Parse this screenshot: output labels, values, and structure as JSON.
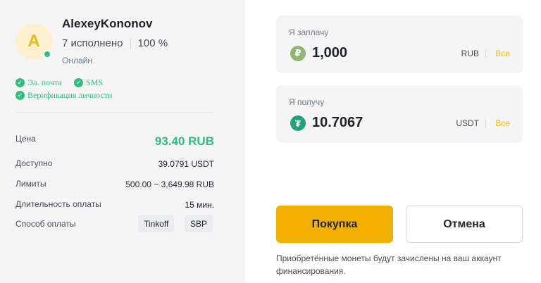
{
  "trader": {
    "avatar_letter": "A",
    "username": "AlexeyKononov",
    "orders_completed": "7 исполнено",
    "completion_rate": "100 %",
    "status": "Онлайн",
    "verifications": {
      "email": "Эл. почта",
      "sms": "SMS",
      "identity": "Верификация личности"
    }
  },
  "details": {
    "price_label": "Цена",
    "price_value": "93.40 RUB",
    "available_label": "Доступно",
    "available_value": "39.0791 USDT",
    "limits_label": "Лимиты",
    "limits_value": "500.00 ~ 3,649.98 RUB",
    "duration_label": "Длительность оплаты",
    "duration_value": "15 мин.",
    "payment_label": "Способ оплаты",
    "payment_methods": [
      "Tinkoff",
      "SBP"
    ]
  },
  "pay": {
    "label": "Я заплачу",
    "amount": "1,000",
    "currency": "RUB",
    "all": "Все",
    "coin_symbol": "₽"
  },
  "receive": {
    "label": "Я получу",
    "amount": "10.7067",
    "currency": "USDT",
    "all": "Все",
    "coin_symbol": "₮"
  },
  "actions": {
    "buy_label": "Покупка",
    "cancel_label": "Отмена"
  },
  "note": "Приобретённые монеты будут зачислены на ваш аккаунт финансирования.",
  "colors": {
    "accent": "#f3b000",
    "success": "#2ebd85",
    "rub_coin": "#8fb570",
    "usdt_coin": "#26a17b"
  }
}
